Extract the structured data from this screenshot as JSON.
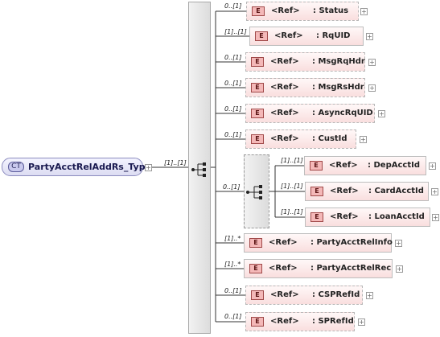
{
  "complex_type": {
    "badge": "CT",
    "name": "PartyAcctRelAddRs_Type",
    "cardinality": "[1]..[1]"
  },
  "choice_cardinality": "0..[1]",
  "elements": [
    {
      "ref": "<Ref>",
      "name": ": Status",
      "cardinality": "0..[1]",
      "optional": true
    },
    {
      "ref": "<Ref>",
      "name": ": RqUID",
      "cardinality": "[1]..[1]",
      "optional": false
    },
    {
      "ref": "<Ref>",
      "name": ": MsgRqHdr",
      "cardinality": "0..[1]",
      "optional": true
    },
    {
      "ref": "<Ref>",
      "name": ": MsgRsHdr",
      "cardinality": "0..[1]",
      "optional": true
    },
    {
      "ref": "<Ref>",
      "name": ": AsyncRqUID",
      "cardinality": "0..[1]",
      "optional": true
    },
    {
      "ref": "<Ref>",
      "name": ": CustId",
      "cardinality": "0..[1]",
      "optional": true
    },
    {
      "ref": "<Ref>",
      "name": ": PartyAcctRelInfo",
      "cardinality": "[1]..*",
      "optional": false
    },
    {
      "ref": "<Ref>",
      "name": ": PartyAcctRelRec",
      "cardinality": "[1]..*",
      "optional": false
    },
    {
      "ref": "<Ref>",
      "name": ": CSPRefId",
      "cardinality": "0..[1]",
      "optional": true
    },
    {
      "ref": "<Ref>",
      "name": ": SPRefId",
      "cardinality": "0..[1]",
      "optional": true
    }
  ],
  "choice_elements": [
    {
      "ref": "<Ref>",
      "name": ": DepAcctId",
      "cardinality": "[1]..[1]"
    },
    {
      "ref": "<Ref>",
      "name": ": CardAcctId",
      "cardinality": "[1]..[1]"
    },
    {
      "ref": "<Ref>",
      "name": ": LoanAcctId",
      "cardinality": "[1]..[1]"
    }
  ],
  "badges": {
    "element": "E",
    "expand": "+"
  }
}
